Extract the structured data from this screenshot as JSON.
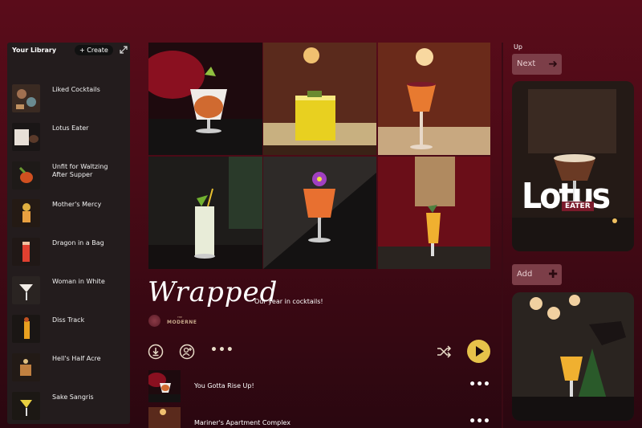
{
  "library": {
    "title": "Your Library",
    "create_label": "+ Create",
    "items": [
      {
        "label": "Liked Cocktails"
      },
      {
        "label": "Lotus Eater"
      },
      {
        "label": "Unfit for Waltzing After Supper"
      },
      {
        "label": "Mother's Mercy"
      },
      {
        "label": "Dragon in a Bag"
      },
      {
        "label": "Woman in White"
      },
      {
        "label": "Diss Track"
      },
      {
        "label": "Hell's Half Acre"
      },
      {
        "label": "Sake Sangris"
      }
    ]
  },
  "playlist": {
    "title": "Wrapped",
    "subtitle": "Our year in cocktails!",
    "brand_name": "MODERNE",
    "brand_prefix": "THE"
  },
  "tracks": [
    {
      "name": "You Gotta Rise Up!"
    },
    {
      "name": "Mariner's Apartment Complex"
    }
  ],
  "sidebar": {
    "up_label": "Up",
    "next_label": "Next",
    "add_label": "Add",
    "card_title_big": "Lotus",
    "card_title_small": "EATER"
  },
  "colors": {
    "accent": "#e6c24a",
    "background": "#4a0a16",
    "panel": "#231c1d",
    "side_button": "#7c3e48"
  }
}
